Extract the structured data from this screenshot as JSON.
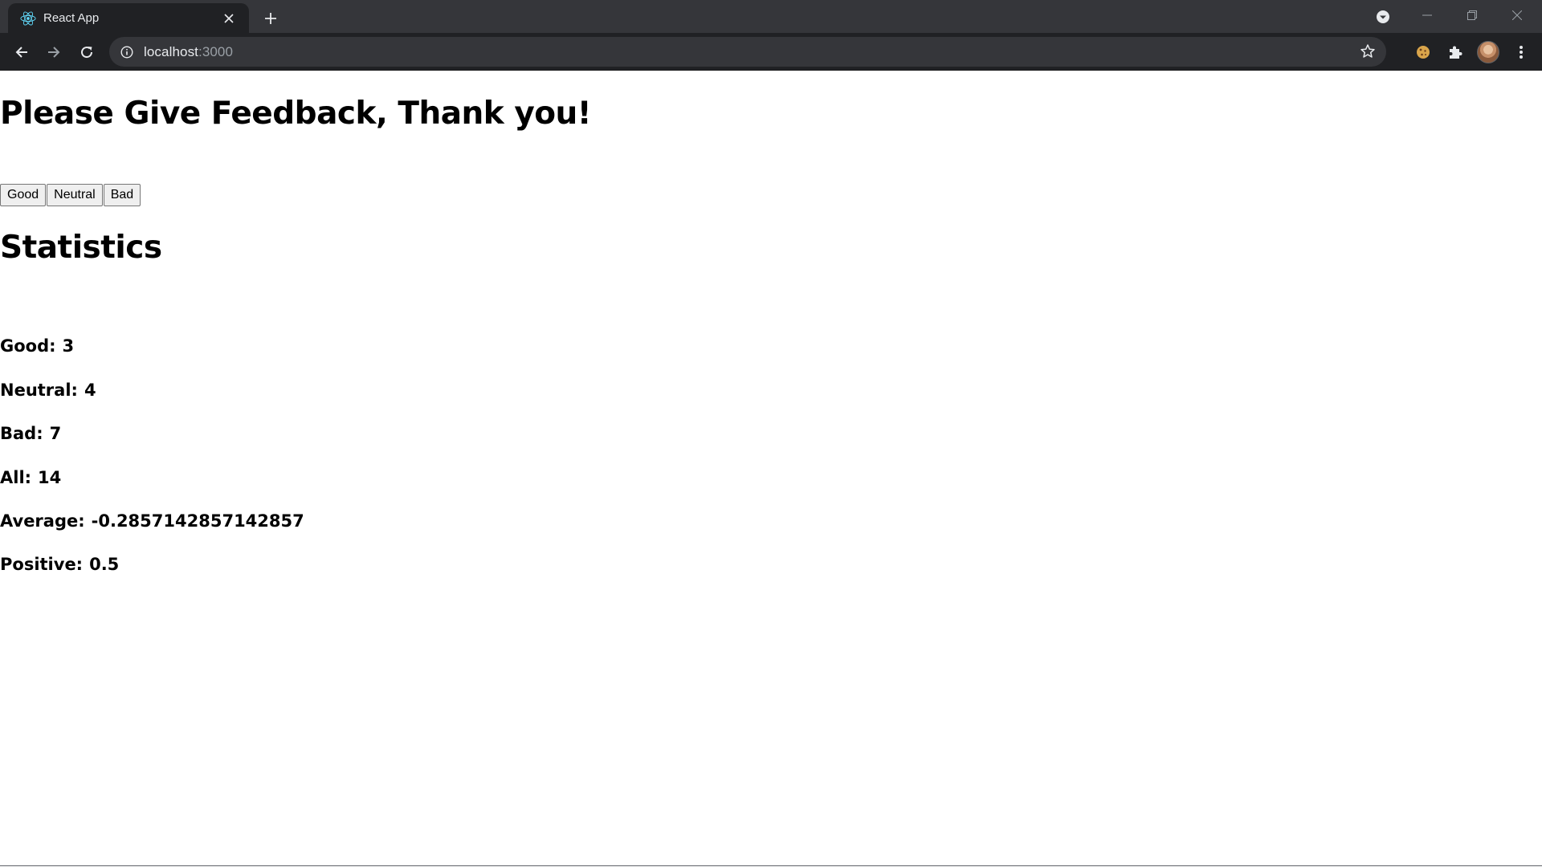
{
  "browser": {
    "tab": {
      "title": "React App",
      "favicon": "react-logo-icon"
    },
    "address_bar": {
      "host": "localhost",
      "port": ":3000"
    },
    "colors": {
      "chrome_dark": "#202124",
      "tabstrip": "#35363a",
      "react_accent": "#61dafb"
    }
  },
  "page": {
    "title": "Please Give Feedback, Thank you!",
    "buttons": [
      {
        "label": "Good"
      },
      {
        "label": "Neutral"
      },
      {
        "label": "Bad"
      }
    ],
    "stats_title": "Statistics",
    "stats": [
      {
        "label": "Good:",
        "value": "3"
      },
      {
        "label": "Neutral:",
        "value": "4"
      },
      {
        "label": "Bad:",
        "value": "7"
      },
      {
        "label": "All:",
        "value": "14"
      },
      {
        "label": "Average:",
        "value": "-0.2857142857142857"
      },
      {
        "label": "Positive:",
        "value": "0.5"
      }
    ]
  }
}
